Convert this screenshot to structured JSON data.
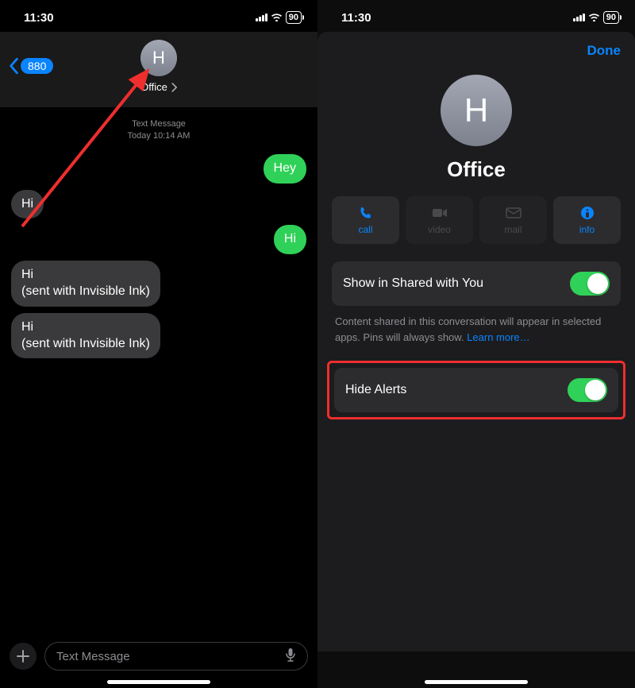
{
  "status": {
    "time": "11:30",
    "battery": "90"
  },
  "left": {
    "back_badge": "880",
    "avatar_initial": "H",
    "contact_name": "Office",
    "meta_line1": "Text Message",
    "meta_line2": "Today 10:14 AM",
    "messages": [
      {
        "dir": "out",
        "text": "Hey"
      },
      {
        "dir": "in",
        "text": "Hi"
      },
      {
        "dir": "out",
        "text": "Hi"
      },
      {
        "dir": "in",
        "text": "Hi\n(sent with Invisible Ink)"
      },
      {
        "dir": "in",
        "text": "Hi\n(sent with Invisible Ink)"
      }
    ],
    "input_placeholder": "Text Message"
  },
  "right": {
    "done_label": "Done",
    "avatar_initial": "H",
    "contact_name": "Office",
    "actions": [
      {
        "id": "call",
        "label": "call",
        "enabled": true
      },
      {
        "id": "video",
        "label": "video",
        "enabled": false
      },
      {
        "id": "mail",
        "label": "mail",
        "enabled": false
      },
      {
        "id": "info",
        "label": "info",
        "enabled": true
      }
    ],
    "shared_label": "Show in Shared with You",
    "shared_on": true,
    "shared_explain": "Content shared in this conversation will appear in selected apps. Pins will always show. ",
    "shared_learn": "Learn more…",
    "hide_label": "Hide Alerts",
    "hide_on": true
  }
}
